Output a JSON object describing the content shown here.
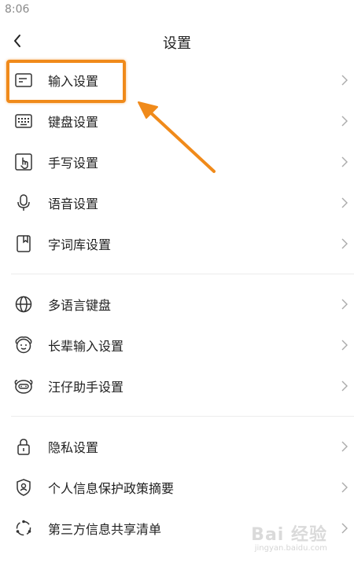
{
  "status_bar": {
    "time": "8:06"
  },
  "header": {
    "title": "设置"
  },
  "sections": [
    {
      "items": [
        {
          "label": "输入设置",
          "icon": "input-box-icon"
        },
        {
          "label": "键盘设置",
          "icon": "keyboard-icon"
        },
        {
          "label": "手写设置",
          "icon": "handwriting-icon"
        },
        {
          "label": "语音设置",
          "icon": "microphone-icon"
        },
        {
          "label": "字词库设置",
          "icon": "dictionary-icon"
        }
      ]
    },
    {
      "items": [
        {
          "label": "多语言键盘",
          "icon": "globe-icon"
        },
        {
          "label": "长辈输入设置",
          "icon": "elder-face-icon"
        },
        {
          "label": "汪仔助手设置",
          "icon": "assistant-face-icon"
        }
      ]
    },
    {
      "items": [
        {
          "label": "隐私设置",
          "icon": "lock-icon"
        },
        {
          "label": "个人信息保护政策摘要",
          "icon": "shield-user-icon"
        },
        {
          "label": "第三方信息共享清单",
          "icon": "share-circle-icon"
        }
      ]
    }
  ],
  "annotation": {
    "color": "#f08a1a"
  },
  "watermark": {
    "text": "Bai 经验",
    "sub": "jingyan.baidu.com"
  }
}
